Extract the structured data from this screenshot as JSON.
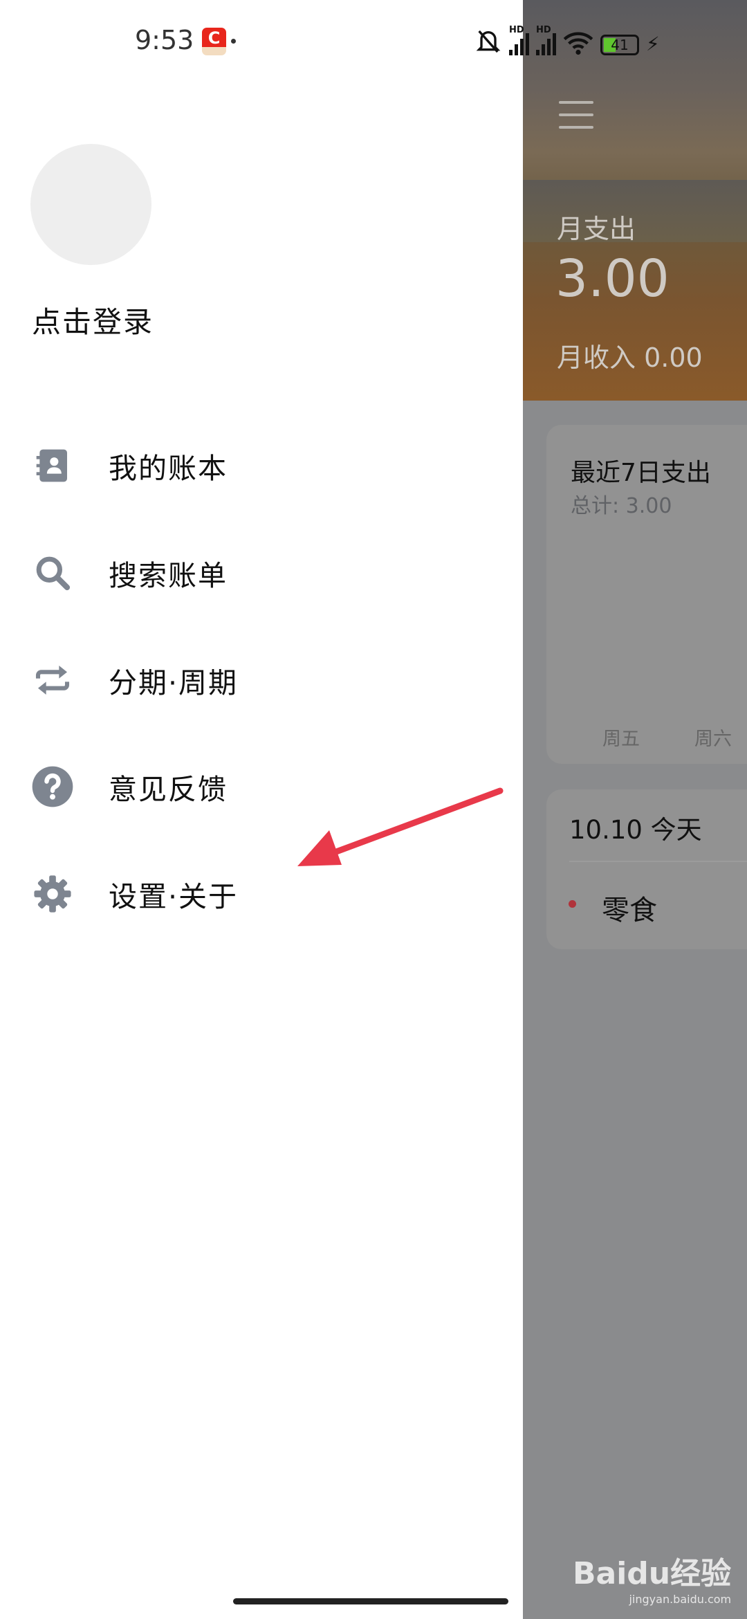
{
  "status_bar": {
    "time": "9:53",
    "app_badge": "C",
    "battery": "41",
    "network": [
      "HD",
      "HD"
    ]
  },
  "drawer": {
    "login_label": "点击登录",
    "menu": [
      {
        "label": "我的账本",
        "icon": "contacts-book-icon"
      },
      {
        "label": "搜索账单",
        "icon": "search-icon"
      },
      {
        "label": "分期·周期",
        "icon": "repeat-icon"
      },
      {
        "label": "意见反馈",
        "icon": "help-circle-icon"
      },
      {
        "label": "设置·关于",
        "icon": "gear-icon"
      }
    ]
  },
  "main": {
    "month_expense_label": "月支出",
    "month_expense": "3.00",
    "month_income": "月收入 0.00",
    "weekly_card": {
      "title": "最近7日支出",
      "total": "总计: 3.00",
      "days": [
        "周五",
        "周六"
      ]
    },
    "day_card": {
      "date": "10.10 今天",
      "items": [
        {
          "category": "零食",
          "dot_color": "#b0333b"
        }
      ]
    }
  },
  "watermark": {
    "text": "Baidu经验",
    "url": "jingyan.baidu.com"
  },
  "colors": {
    "overlay": "#8a8b8d",
    "icon_gray": "#7e8590",
    "arrow": "#e8394a"
  }
}
